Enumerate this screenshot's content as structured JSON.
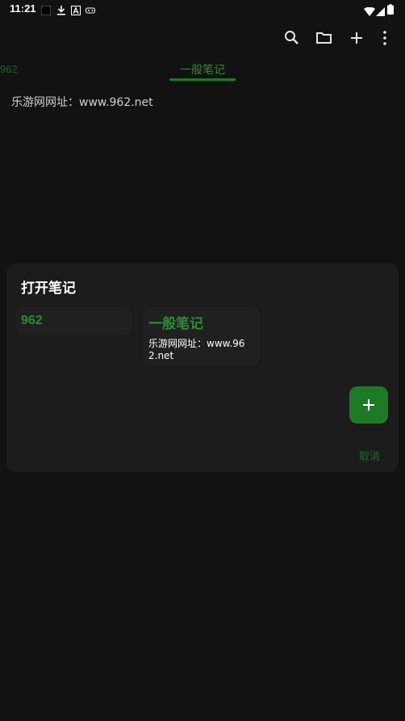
{
  "status_bar": {
    "time": "11:21",
    "icons": [
      "notification-square-icon",
      "download-icon",
      "text-a-icon",
      "gamepad-icon",
      "wifi-icon",
      "signal-icon",
      "battery-icon"
    ]
  },
  "toolbar": {
    "icons": [
      "search-icon",
      "folder-icon",
      "add-icon",
      "more-icon"
    ]
  },
  "tabs": [
    {
      "label": "962"
    },
    {
      "label": "一般笔记"
    }
  ],
  "note": {
    "text": "乐游网网址：www.962.net"
  },
  "dialog": {
    "title": "打开笔记",
    "notebooks": [
      {
        "title": "962",
        "preview": ""
      },
      {
        "title": "一般笔记",
        "preview": "乐游网网址：www.962.net"
      }
    ],
    "cancel_label": "取消"
  },
  "colors": {
    "background": "#121212",
    "dialog": "#1c1c1c",
    "card": "#202020",
    "accent": "#2e8b35",
    "fab": "#1f7a27"
  }
}
